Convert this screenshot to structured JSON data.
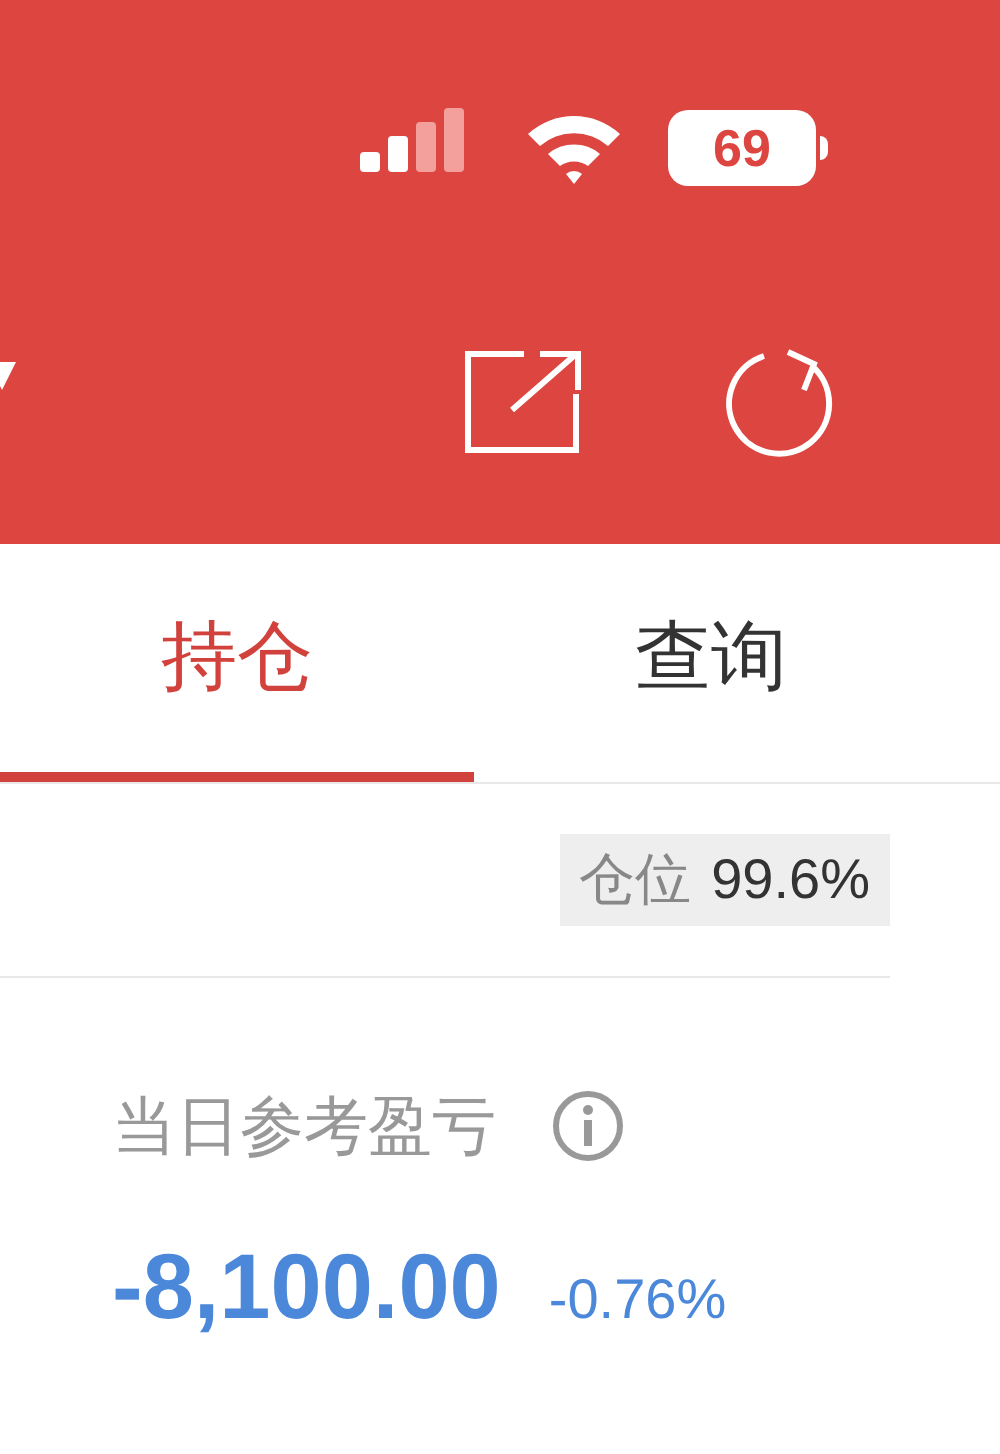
{
  "status_bar": {
    "battery": "69"
  },
  "tabs": [
    {
      "label": "持仓",
      "selected": true
    },
    {
      "label": "查询",
      "selected": false
    }
  ],
  "position_badge": {
    "label": "仓位",
    "value": "99.6%"
  },
  "daily_pnl": {
    "label": "当日参考盈亏",
    "amount": "-8,100.00",
    "percent": "-0.76%"
  }
}
